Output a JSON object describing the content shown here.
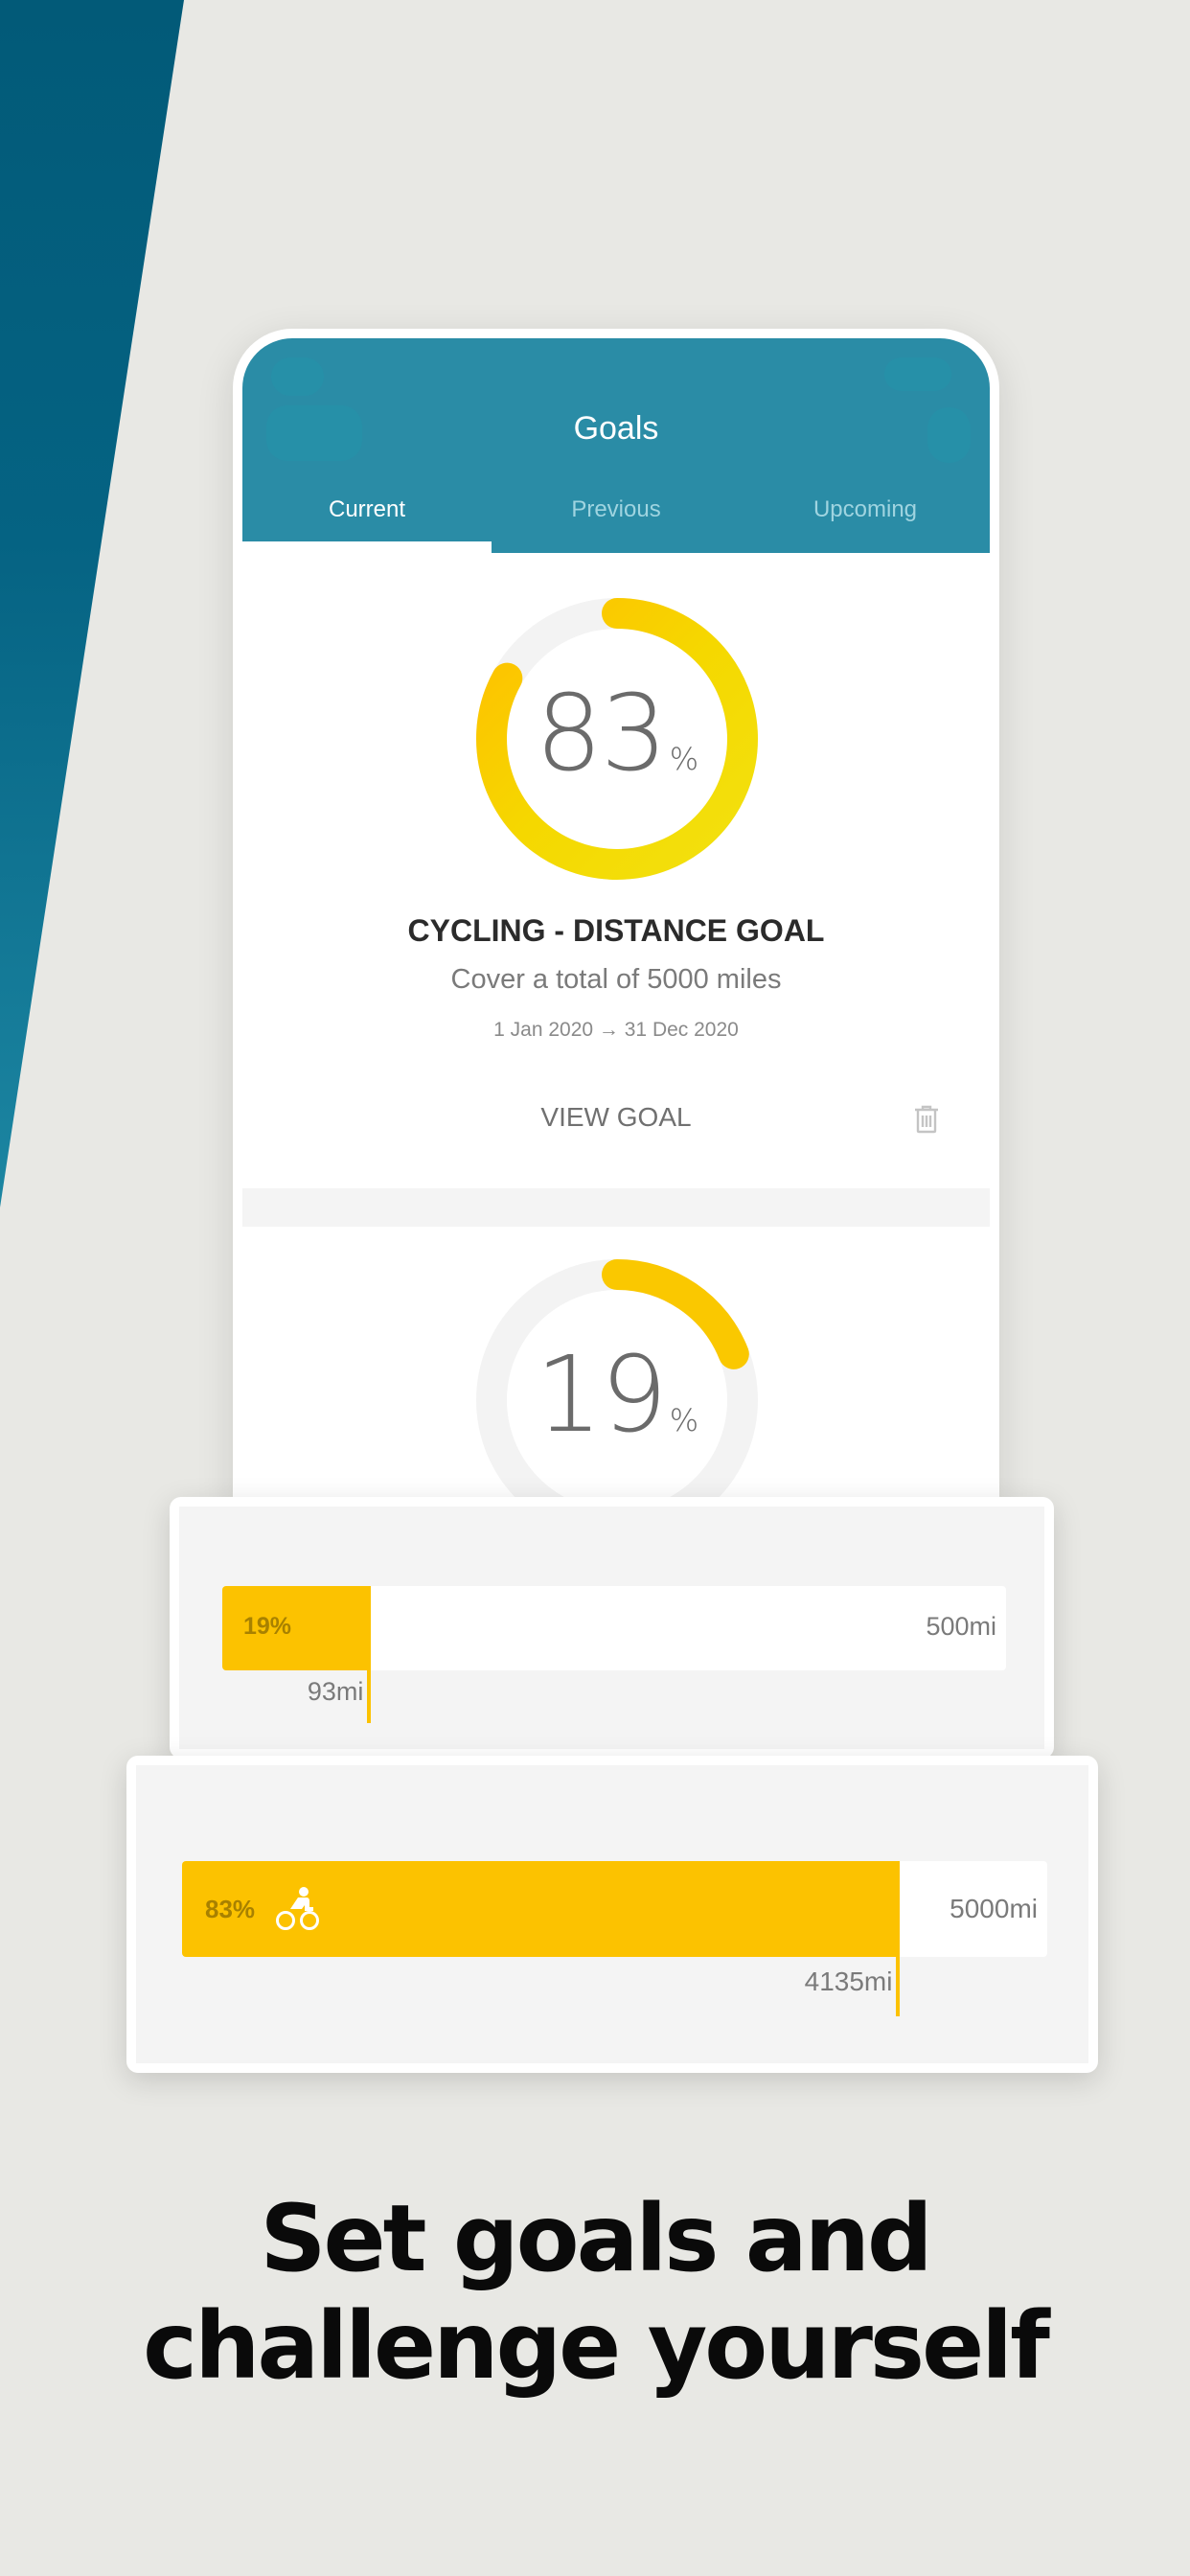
{
  "colors": {
    "background": "#e8e8e4",
    "stripe_top": "#025a78",
    "stripe_bottom": "#1a7f9c",
    "header": "#2a8ca6",
    "accent": "#fcc200",
    "ring_start": "#fff01e",
    "ring_end": "#ffc000",
    "ring_track": "#f3f3f3"
  },
  "header": {
    "title": "Goals",
    "tabs": [
      {
        "label": "Current",
        "active": true
      },
      {
        "label": "Previous",
        "active": false
      },
      {
        "label": "Upcoming",
        "active": false
      }
    ]
  },
  "goals": [
    {
      "percent": 83,
      "percent_sign": "%",
      "title": "CYCLING - DISTANCE GOAL",
      "subtitle": "Cover a total of 5000 miles",
      "dates": "1 Jan 2020 → 31 Dec 2020",
      "view_label": "VIEW GOAL",
      "icon": "trash-icon"
    },
    {
      "percent": 19,
      "percent_sign": "%"
    }
  ],
  "progress_cards": [
    {
      "percent_label": "19%",
      "progress": 0.19,
      "current_label": "93mi",
      "goal_label": "500mi",
      "icon": null
    },
    {
      "percent_label": "83%",
      "progress": 0.83,
      "current_label": "4135mi",
      "goal_label": "5000mi",
      "icon": "bicycle-icon"
    }
  ],
  "headline": {
    "line1": "Set goals and",
    "line2": "challenge yourself"
  }
}
